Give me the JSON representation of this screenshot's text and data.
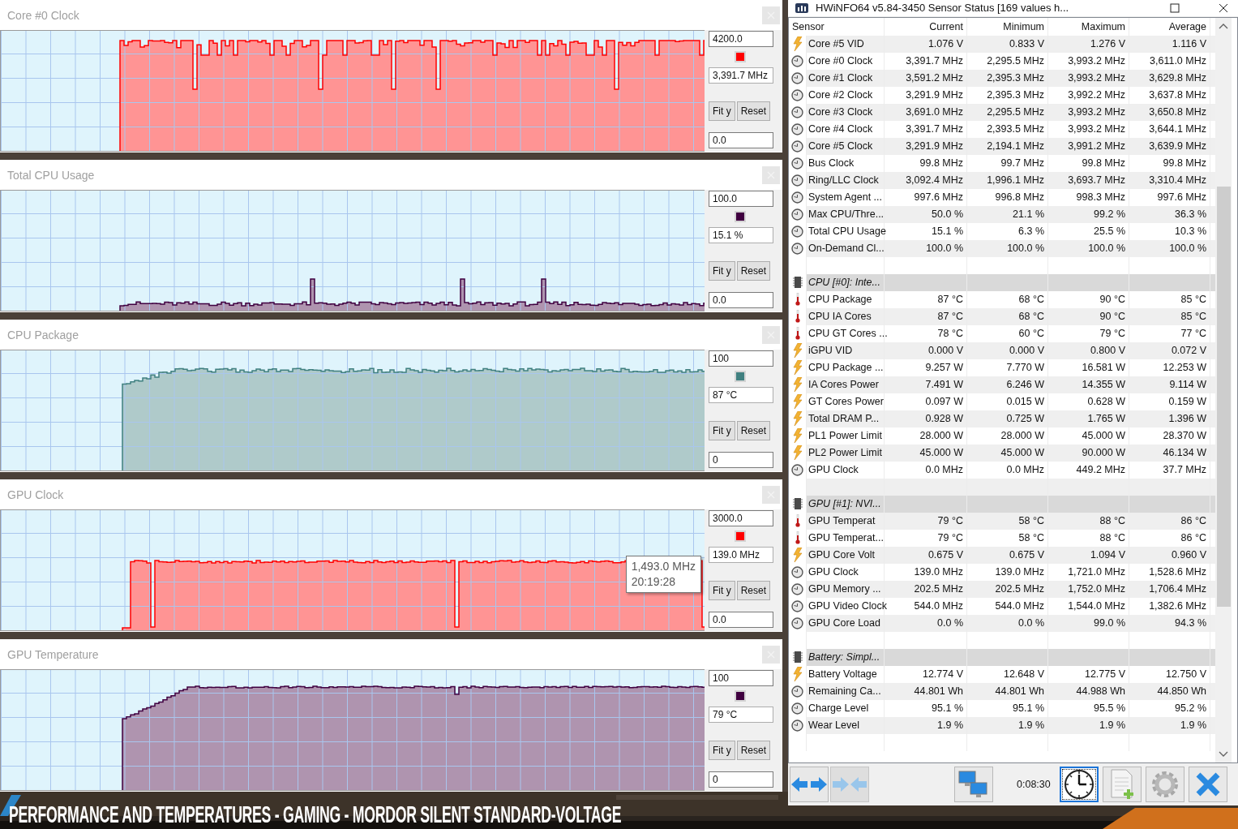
{
  "graphs": [
    {
      "title": "Core #0 Clock",
      "max": "4200.0",
      "color": "#ff0000",
      "current": "3,391.7 MHz",
      "buttons": [
        "Fit y",
        "Reset"
      ],
      "min": "0.0"
    },
    {
      "title": "Total CPU Usage",
      "max": "100.0",
      "color": "#400040",
      "current": "15.1 %",
      "buttons": [
        "Fit y",
        "Reset"
      ],
      "min": "0.0"
    },
    {
      "title": "CPU Package",
      "max": "100",
      "color": "#408080",
      "current": "87 °C",
      "buttons": [
        "Fit y",
        "Reset"
      ],
      "min": "0"
    },
    {
      "title": "GPU Clock",
      "max": "3000.0",
      "color": "#ff0000",
      "current": "139.0 MHz",
      "buttons": [
        "Fit y",
        "Reset"
      ],
      "min": "0.0",
      "tooltip": {
        "value": "1,493.0 MHz",
        "time": "20:19:28"
      }
    },
    {
      "title": "GPU Temperature",
      "max": "100",
      "color": "#400040",
      "current": "79 °C",
      "buttons": [
        "Fit y",
        "Reset"
      ],
      "min": "0"
    }
  ],
  "caption": "PERFORMANCE AND TEMPERATURES - GAMING - MORDOR SILENT STANDARD-VOLTAGE",
  "window": {
    "title": "HWiNFO64 v5.84-3450 Sensor Status [169 values h..."
  },
  "table": {
    "columns": [
      "Sensor",
      "Current",
      "Minimum",
      "Maximum",
      "Average"
    ],
    "rows": [
      {
        "kind": "voltage",
        "name": "Core #5 VID",
        "values": [
          "1.076 V",
          "0.833 V",
          "1.276 V",
          "1.116 V"
        ]
      },
      {
        "kind": "clock",
        "name": "Core #0 Clock",
        "values": [
          "3,391.7 MHz",
          "2,295.5 MHz",
          "3,993.2 MHz",
          "3,611.0 MHz"
        ]
      },
      {
        "kind": "clock",
        "name": "Core #1 Clock",
        "values": [
          "3,591.2 MHz",
          "2,395.3 MHz",
          "3,993.2 MHz",
          "3,629.8 MHz"
        ]
      },
      {
        "kind": "clock",
        "name": "Core #2 Clock",
        "values": [
          "3,291.9 MHz",
          "2,395.3 MHz",
          "3,992.2 MHz",
          "3,637.8 MHz"
        ]
      },
      {
        "kind": "clock",
        "name": "Core #3 Clock",
        "values": [
          "3,691.0 MHz",
          "2,295.5 MHz",
          "3,993.2 MHz",
          "3,650.8 MHz"
        ]
      },
      {
        "kind": "clock",
        "name": "Core #4 Clock",
        "values": [
          "3,391.7 MHz",
          "2,393.5 MHz",
          "3,993.2 MHz",
          "3,644.1 MHz"
        ]
      },
      {
        "kind": "clock",
        "name": "Core #5 Clock",
        "values": [
          "3,291.9 MHz",
          "2,194.1 MHz",
          "3,991.2 MHz",
          "3,639.9 MHz"
        ]
      },
      {
        "kind": "clock",
        "name": "Bus Clock",
        "values": [
          "99.8 MHz",
          "99.7 MHz",
          "99.8 MHz",
          "99.8 MHz"
        ]
      },
      {
        "kind": "clock",
        "name": "Ring/LLC Clock",
        "values": [
          "3,092.4 MHz",
          "1,996.1 MHz",
          "3,693.7 MHz",
          "3,310.4 MHz"
        ]
      },
      {
        "kind": "clock",
        "name": "System Agent ...",
        "values": [
          "997.6 MHz",
          "996.8 MHz",
          "998.3 MHz",
          "997.6 MHz"
        ]
      },
      {
        "kind": "percent",
        "name": "Max CPU/Thre...",
        "values": [
          "50.0 %",
          "21.1 %",
          "99.2 %",
          "36.3 %"
        ]
      },
      {
        "kind": "percent",
        "name": "Total CPU Usage",
        "values": [
          "15.1 %",
          "6.3 %",
          "25.5 %",
          "10.3 %"
        ]
      },
      {
        "kind": "percent",
        "name": "On-Demand Cl...",
        "values": [
          "100.0 %",
          "100.0 %",
          "100.0 %",
          "100.0 %"
        ]
      },
      {
        "kind": "spacer"
      },
      {
        "kind": "group",
        "name": "CPU [#0]: Inte..."
      },
      {
        "kind": "temperature",
        "name": "CPU Package",
        "values": [
          "87 °C",
          "68 °C",
          "90 °C",
          "85 °C"
        ]
      },
      {
        "kind": "temperature",
        "name": "CPU IA Cores",
        "values": [
          "87 °C",
          "68 °C",
          "90 °C",
          "85 °C"
        ]
      },
      {
        "kind": "temperature",
        "name": "CPU GT Cores ...",
        "values": [
          "78 °C",
          "60 °C",
          "79 °C",
          "77 °C"
        ]
      },
      {
        "kind": "voltage",
        "name": "iGPU VID",
        "values": [
          "0.000 V",
          "0.000 V",
          "0.800 V",
          "0.072 V"
        ]
      },
      {
        "kind": "power",
        "name": "CPU Package ...",
        "values": [
          "9.257 W",
          "7.770 W",
          "16.581 W",
          "12.253 W"
        ]
      },
      {
        "kind": "power",
        "name": "IA Cores Power",
        "values": [
          "7.491 W",
          "6.246 W",
          "14.355 W",
          "9.114 W"
        ]
      },
      {
        "kind": "power",
        "name": "GT Cores Power",
        "values": [
          "0.097 W",
          "0.015 W",
          "0.628 W",
          "0.159 W"
        ]
      },
      {
        "kind": "power",
        "name": "Total DRAM P...",
        "values": [
          "0.928 W",
          "0.725 W",
          "1.765 W",
          "1.396 W"
        ]
      },
      {
        "kind": "power",
        "name": "PL1 Power Limit",
        "values": [
          "28.000 W",
          "28.000 W",
          "45.000 W",
          "28.370 W"
        ]
      },
      {
        "kind": "power",
        "name": "PL2 Power Limit",
        "values": [
          "45.000 W",
          "45.000 W",
          "90.000 W",
          "46.134 W"
        ]
      },
      {
        "kind": "clock",
        "name": "GPU Clock",
        "values": [
          "0.0 MHz",
          "0.0 MHz",
          "449.2 MHz",
          "37.7 MHz"
        ]
      },
      {
        "kind": "spacer"
      },
      {
        "kind": "group",
        "name": "GPU [#1]: NVI..."
      },
      {
        "kind": "temperature",
        "name": "GPU Temperat",
        "values": [
          "79 °C",
          "58 °C",
          "88 °C",
          "86 °C"
        ]
      },
      {
        "kind": "temperature",
        "name": "GPU Temperat...",
        "values": [
          "79 °C",
          "58 °C",
          "88 °C",
          "86 °C"
        ]
      },
      {
        "kind": "voltage",
        "name": "GPU Core Volt",
        "values": [
          "0.675 V",
          "0.675 V",
          "1.094 V",
          "0.960 V"
        ]
      },
      {
        "kind": "clock",
        "name": "GPU Clock",
        "values": [
          "139.0 MHz",
          "139.0 MHz",
          "1,721.0 MHz",
          "1,528.6 MHz"
        ]
      },
      {
        "kind": "clock",
        "name": "GPU Memory ...",
        "values": [
          "202.5 MHz",
          "202.5 MHz",
          "1,752.0 MHz",
          "1,706.4 MHz"
        ]
      },
      {
        "kind": "clock",
        "name": "GPU Video Clock",
        "values": [
          "544.0 MHz",
          "544.0 MHz",
          "1,544.0 MHz",
          "1,382.6 MHz"
        ]
      },
      {
        "kind": "percent",
        "name": "GPU Core Load",
        "values": [
          "0.0 %",
          "0.0 %",
          "99.0 %",
          "94.3 %"
        ]
      },
      {
        "kind": "spacer"
      },
      {
        "kind": "group",
        "name": "Battery: Simpl..."
      },
      {
        "kind": "voltage",
        "name": "Battery Voltage",
        "values": [
          "12.774 V",
          "12.648 V",
          "12.775 V",
          "12.750 V"
        ]
      },
      {
        "kind": "energy",
        "name": "Remaining Ca...",
        "values": [
          "44.801 Wh",
          "44.801 Wh",
          "44.988 Wh",
          "44.850 Wh"
        ]
      },
      {
        "kind": "percent",
        "name": "Charge Level",
        "values": [
          "95.1 %",
          "95.1 %",
          "95.5 %",
          "95.2 %"
        ]
      },
      {
        "kind": "percent",
        "name": "Wear Level",
        "values": [
          "1.9 %",
          "1.9 %",
          "1.9 %",
          "1.9 %"
        ]
      },
      {
        "kind": "spacer"
      }
    ]
  },
  "toolbar": {
    "buttons": [
      {
        "kind": "expand",
        "selected": false,
        "disabled": false
      },
      {
        "kind": "collapse",
        "selected": false,
        "disabled": true
      },
      {
        "kind": "network",
        "selected": false,
        "disabled": false
      },
      {
        "kind": "clock",
        "selected": true,
        "disabled": false
      },
      {
        "kind": "report",
        "selected": false,
        "disabled": false
      },
      {
        "kind": "settings",
        "selected": false,
        "disabled": false
      },
      {
        "kind": "close",
        "selected": false,
        "disabled": false
      }
    ],
    "elapsed": "0:08:30"
  }
}
